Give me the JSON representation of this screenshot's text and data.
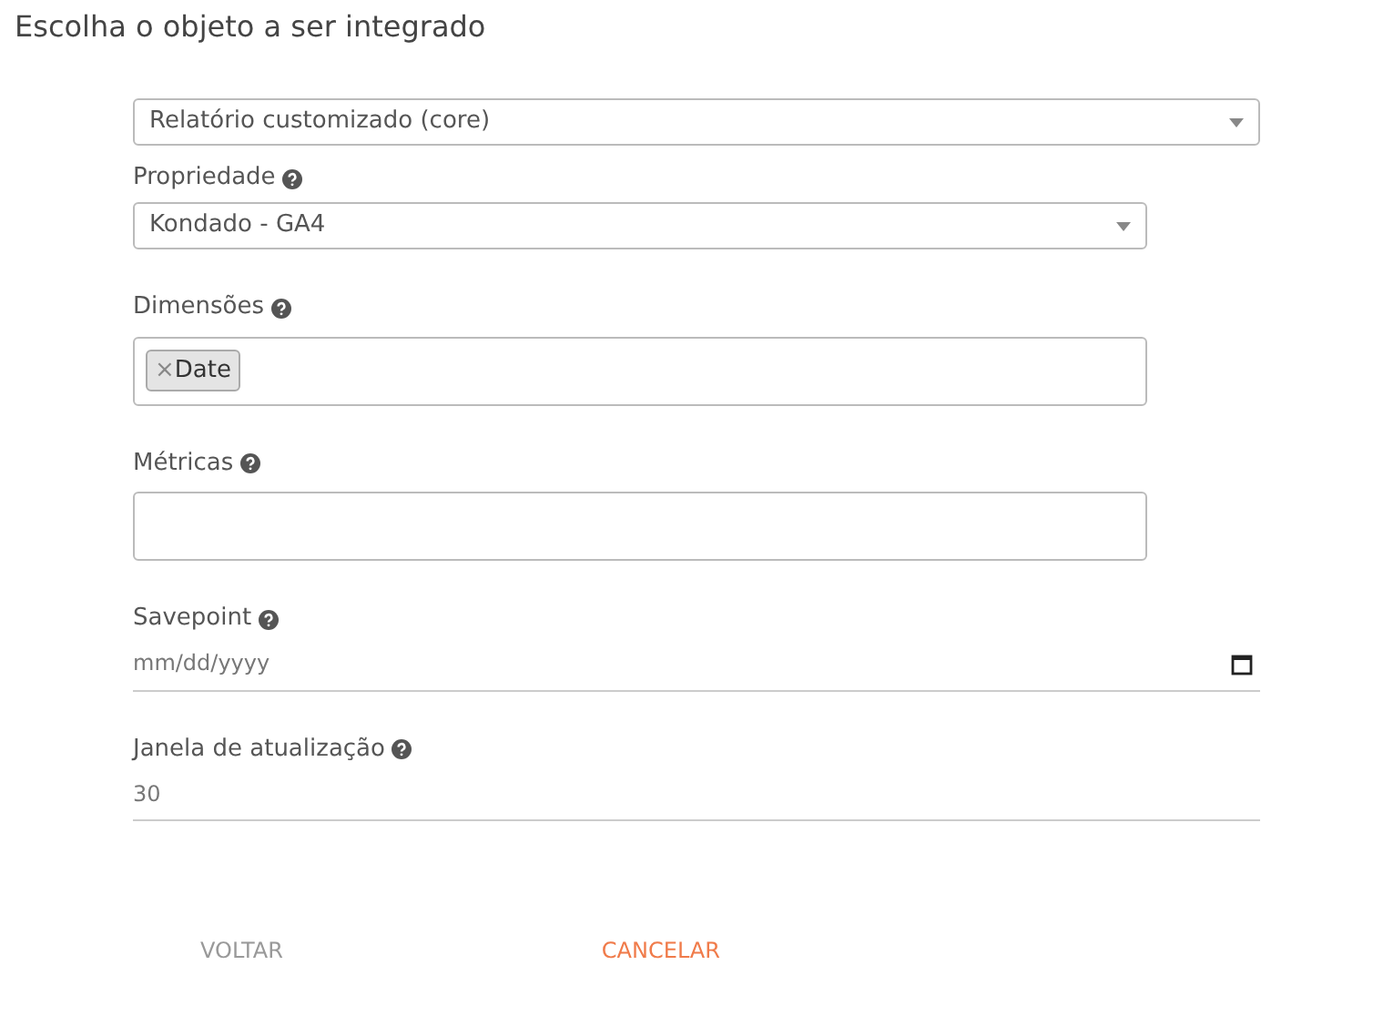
{
  "title": "Escolha o objeto a ser integrado",
  "fields": [
    {
      "kind": "select",
      "value": "Relatório customizado (core)"
    },
    {
      "kind": "select",
      "label": "Propriedade",
      "value": "Kondado - GA4"
    },
    {
      "kind": "tags",
      "label": "Dimensões",
      "tags": [
        "Date"
      ]
    },
    {
      "kind": "tags",
      "label": "Métricas"
    },
    {
      "kind": "date",
      "label": "Savepoint",
      "placeholder": "mm/dd/yyyy"
    },
    {
      "kind": "number",
      "label": "Janela de atualização",
      "value": "30"
    }
  ],
  "tag_remove": "×",
  "buttons": [
    {
      "label": "VOLTAR",
      "kind": "back"
    },
    {
      "label": "CANCELAR",
      "kind": "cancel"
    }
  ]
}
